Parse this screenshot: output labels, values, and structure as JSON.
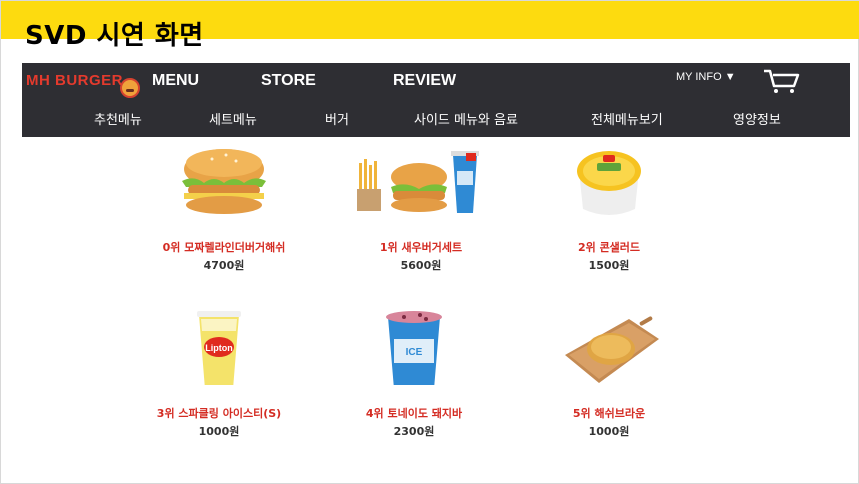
{
  "slide": {
    "title": "SVD 시연 화면"
  },
  "header": {
    "logo_text": "MH BURGER",
    "menu": [
      "MENU",
      "STORE",
      "REVIEW"
    ],
    "my_info": "MY INFO ▼"
  },
  "submenu": [
    "추천메뉴",
    "세트메뉴",
    "버거",
    "사이드 메뉴와 음료",
    "전체메뉴보기",
    "영양정보"
  ],
  "products": [
    {
      "rank": "0위",
      "name": "모짜렐라인더버거해쉬",
      "price": "4700원",
      "image": "burger-icon"
    },
    {
      "rank": "1위",
      "name": "새우버거세트",
      "price": "5600원",
      "image": "burger-set-icon"
    },
    {
      "rank": "2위",
      "name": "콘샐러드",
      "price": "1500원",
      "image": "corn-salad-icon"
    },
    {
      "rank": "3위",
      "name": "스파클링 아이스티(S)",
      "price": "1000원",
      "image": "iced-tea-icon"
    },
    {
      "rank": "4위",
      "name": "토네이도 돼지바",
      "price": "2300원",
      "image": "tornado-icon"
    },
    {
      "rank": "5위",
      "name": "해쉬브라운",
      "price": "1000원",
      "image": "hashbrown-icon"
    }
  ],
  "colors": {
    "slide_accent": "#fddb0f",
    "navbar": "#2e2e33",
    "rank_text": "#d42c23",
    "logo": "#e43a2d"
  }
}
